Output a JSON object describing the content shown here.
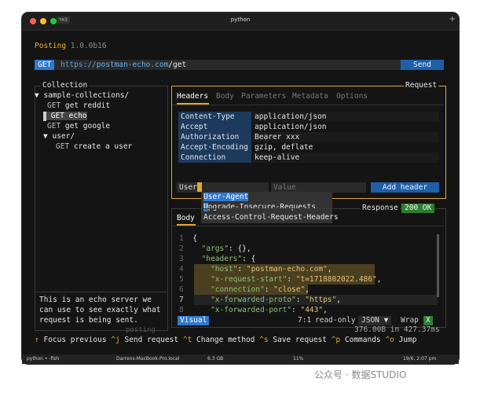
{
  "window": {
    "title": "python",
    "shortcut": "⌥⌘3",
    "new_tab": "+"
  },
  "app": {
    "name": "Posting",
    "version": "1.0.0b16"
  },
  "url_bar": {
    "method": "GET",
    "scheme": "https://",
    "host": "postman-echo.com",
    "path": "/get",
    "send_label": "Send"
  },
  "collection": {
    "title": "Collection",
    "tree": [
      {
        "arrow": "▼",
        "label": "sample-collections/"
      },
      {
        "method": "GET",
        "label": "get reddit"
      },
      {
        "method": "GET",
        "label": "echo",
        "selected": true
      },
      {
        "method": "GET",
        "label": "get google"
      },
      {
        "arrow": "▼",
        "label": "user/"
      },
      {
        "method": "GET",
        "label": "create a user"
      }
    ],
    "description": [
      "This is an echo server we",
      "can use to see exactly what",
      "request is being sent."
    ],
    "footer_label": "posting"
  },
  "request": {
    "title": "Request",
    "tabs": [
      "Headers",
      "Body",
      "Parameters",
      "Metadata",
      "Options"
    ],
    "active_tab": "Headers",
    "headers": [
      {
        "name": "Content-Type",
        "value": "application/json"
      },
      {
        "name": "Accept",
        "value": "application/json"
      },
      {
        "name": "Authorization",
        "value": "Bearer xxx"
      },
      {
        "name": "Accept-Encoding",
        "value": "gzip, deflate"
      },
      {
        "name": "Connection",
        "value": "keep-alive"
      }
    ],
    "name_input_value": "User",
    "value_placeholder": "Value",
    "add_header_label": "Add header",
    "autocomplete": [
      {
        "pre": "",
        "hl": "User-Agent",
        "post": ""
      },
      {
        "pre": "",
        "hl": "U",
        "post": "pgrade-Insecure-Requests"
      },
      {
        "pre": "Access-Control-Request-Headers",
        "hl": "",
        "post": ""
      }
    ]
  },
  "response": {
    "title": "Response",
    "status": "200 OK",
    "tab": "Body",
    "lines": [
      {
        "n": "1",
        "text": "{"
      },
      {
        "n": "2",
        "key": "\"args\"",
        "rest": ": {},"
      },
      {
        "n": "3",
        "key": "\"headers\"",
        "rest": ": {"
      },
      {
        "n": "4",
        "key": "\"host\"",
        "val": "\"postman-echo.com\"",
        "rest": ",",
        "hl": true
      },
      {
        "n": "5",
        "key": "\"x-request-start\"",
        "val": "\"t=1718802022.486\"",
        "rest": ",",
        "hl": true
      },
      {
        "n": "6",
        "key": "\"connection\"",
        "val": "\"close\"",
        "rest": ",",
        "hl": true
      },
      {
        "n": "7",
        "key": "\"x-forwarded-proto\"",
        "val": "\"https\"",
        "rest": ","
      },
      {
        "n": "8",
        "key": "\"x-forwarded-port\"",
        "val": "\"443\"",
        "rest": ","
      }
    ],
    "mode": "Visual",
    "cursor_pos": "7:1",
    "read_only": "read-only",
    "format": "JSON",
    "wrap": "Wrap",
    "wrap_toggle": "X",
    "size_time": "376.00B in 427.37ms"
  },
  "footer": [
    {
      "key": "↑",
      "label": "Focus previous"
    },
    {
      "key": "^j",
      "label": "Send request"
    },
    {
      "key": "^t",
      "label": "Change method"
    },
    {
      "key": "^s",
      "label": "Save request"
    },
    {
      "key": "^p",
      "label": "Commands"
    },
    {
      "key": "^o",
      "label": "Jump"
    }
  ],
  "tmux_bar": {
    "session": "python • -fish",
    "host": "Darrens-MacBook-Pro.local",
    "mem": "6.3 GB",
    "cpu": "11%",
    "date": "19/6, 2:07 pm"
  },
  "watermark": "公众号 · 数据STUDIO",
  "colors": {
    "accent": "#e3a82b",
    "primary": "#2f78d0",
    "success": "#2e7d32",
    "background": "#141414"
  }
}
